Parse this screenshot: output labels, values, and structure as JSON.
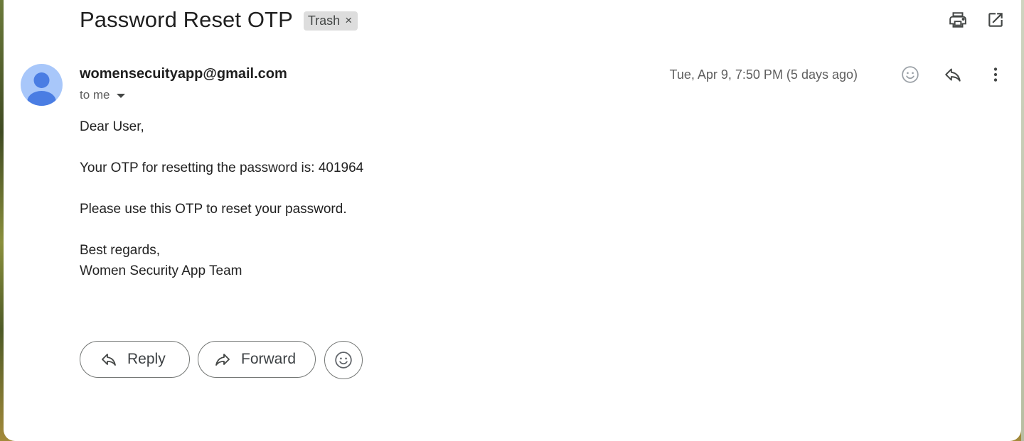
{
  "email": {
    "subject": "Password Reset OTP",
    "label": "Trash",
    "label_remove": "×",
    "sender": "womensecuityapp@gmail.com",
    "recipient": "to me",
    "date": "Tue, Apr 9, 7:50 PM (5 days ago)",
    "body": {
      "greeting": "Dear User,",
      "otp_line": "Your OTP for resetting the password is: 401964",
      "instruction": "Please use this OTP to reset your password.",
      "closing": "Best regards,",
      "signature": "Women Security App Team"
    }
  },
  "actions": {
    "reply_label": "Reply",
    "forward_label": "Forward"
  },
  "icons": {
    "print": "print-icon",
    "open_new_window": "open-in-new-icon",
    "emoji_reaction": "emoji-icon",
    "reply": "reply-icon",
    "more": "more-vert-icon",
    "forward": "forward-icon",
    "avatar": "default-avatar-icon"
  },
  "colors": {
    "avatar_bg": "#a8c7fa",
    "avatar_fg": "#4a7de3",
    "chip_bg": "#dddddd"
  }
}
